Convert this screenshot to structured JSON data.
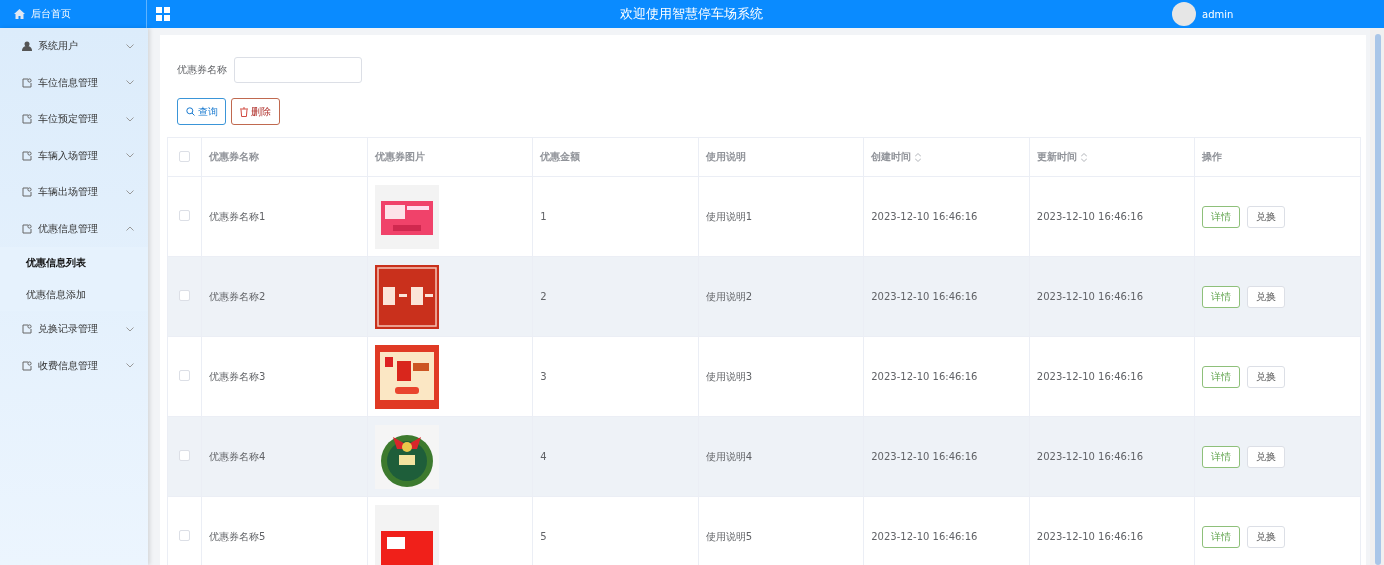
{
  "header": {
    "home_label": "后台首页",
    "title": "欢迎使用智慧停车场系统",
    "user": "admin"
  },
  "sidebar": {
    "items": [
      {
        "label": "系统用户",
        "expanded": false
      },
      {
        "label": "车位信息管理",
        "expanded": false
      },
      {
        "label": "车位预定管理",
        "expanded": false
      },
      {
        "label": "车辆入场管理",
        "expanded": false
      },
      {
        "label": "车辆出场管理",
        "expanded": false
      },
      {
        "label": "优惠信息管理",
        "expanded": true,
        "children": [
          {
            "label": "优惠信息列表",
            "selected": true
          },
          {
            "label": "优惠信息添加",
            "selected": false
          }
        ]
      },
      {
        "label": "兑换记录管理",
        "expanded": false
      },
      {
        "label": "收费信息管理",
        "expanded": false
      }
    ]
  },
  "search": {
    "label": "优惠券名称"
  },
  "buttons": [
    {
      "label": "查询",
      "kind": "search"
    },
    {
      "label": "删除",
      "kind": "delete"
    }
  ],
  "table": {
    "select_all": {
      "checked": false
    },
    "columns": [
      {
        "label": "优惠券名称",
        "sortable": false
      },
      {
        "label": "优惠券图片",
        "sortable": false
      },
      {
        "label": "优惠金额",
        "sortable": false
      },
      {
        "label": "使用说明",
        "sortable": false
      },
      {
        "label": "创建时间",
        "sortable": true
      },
      {
        "label": "更新时间",
        "sortable": true
      },
      {
        "label": "操作",
        "sortable": false
      }
    ],
    "rows": [
      {
        "checked": false,
        "name": "优惠券名称1",
        "amount": "1",
        "description": "使用说明1",
        "created": "2023-12-10 16:46:16",
        "updated": "2023-12-10 16:46:16",
        "actions": [
          "详情",
          "兑换"
        ]
      },
      {
        "checked": false,
        "name": "优惠券名称2",
        "amount": "2",
        "description": "使用说明2",
        "created": "2023-12-10 16:46:16",
        "updated": "2023-12-10 16:46:16",
        "actions": [
          "详情",
          "兑换"
        ]
      },
      {
        "checked": false,
        "name": "优惠券名称3",
        "amount": "3",
        "description": "使用说明3",
        "created": "2023-12-10 16:46:16",
        "updated": "2023-12-10 16:46:16",
        "actions": [
          "详情",
          "兑换"
        ]
      },
      {
        "checked": false,
        "name": "优惠券名称4",
        "amount": "4",
        "description": "使用说明4",
        "created": "2023-12-10 16:46:16",
        "updated": "2023-12-10 16:46:16",
        "actions": [
          "详情",
          "兑换"
        ]
      },
      {
        "checked": false,
        "name": "优惠券名称5",
        "amount": "5",
        "description": "使用说明5",
        "created": "2023-12-10 16:46:16",
        "updated": "2023-12-10 16:46:16",
        "actions": [
          "详情",
          "兑换"
        ]
      }
    ]
  }
}
